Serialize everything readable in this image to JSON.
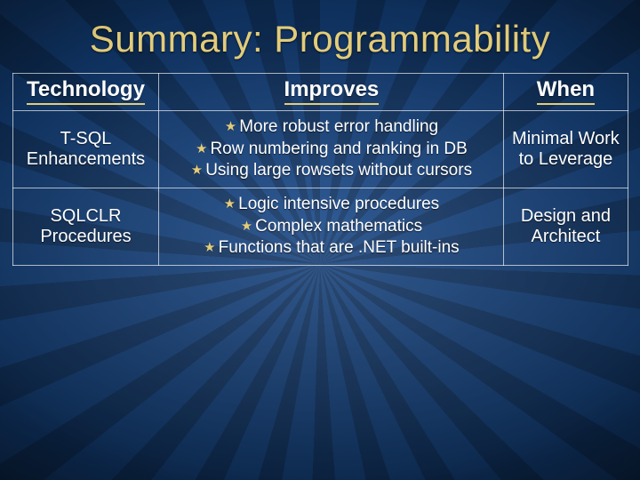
{
  "title": "Summary: Programmability",
  "headers": {
    "technology": "Technology",
    "improves": "Improves",
    "when": "When"
  },
  "star_glyph": "★",
  "rows": [
    {
      "technology_line1": "T-SQL",
      "technology_line2": "Enhancements",
      "improves": [
        "More robust error handling",
        "Row numbering and ranking in DB",
        "Using large rowsets without cursors"
      ],
      "when_line1": "Minimal Work",
      "when_line2": "to Leverage"
    },
    {
      "technology_line1": "SQLCLR",
      "technology_line2": "Procedures",
      "improves": [
        "Logic intensive procedures",
        "Complex mathematics",
        "Functions that are .NET built-ins"
      ],
      "when_line1": "Design and",
      "when_line2": "Architect"
    }
  ]
}
